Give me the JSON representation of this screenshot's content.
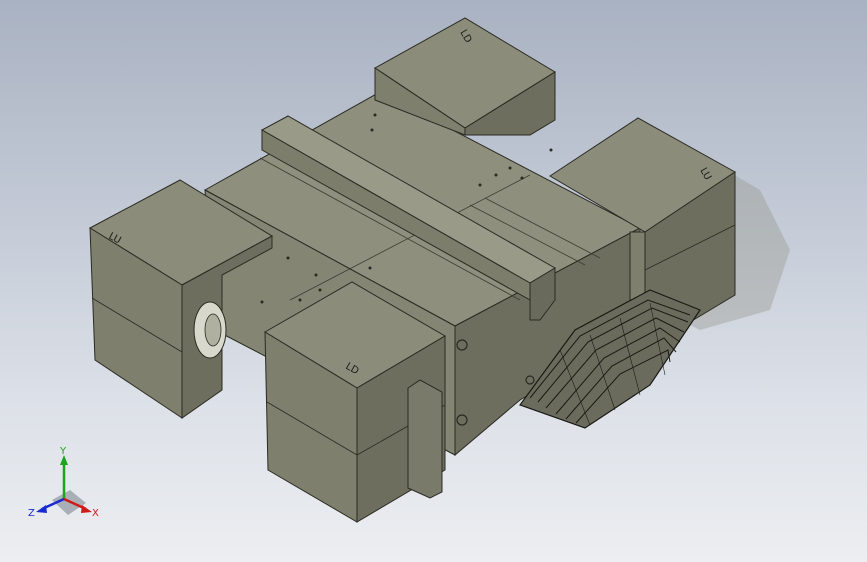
{
  "viewport": {
    "background_top": "#a9b2c2",
    "background_bottom": "#eceef1"
  },
  "model": {
    "body_top_color": "#8f8f7d",
    "body_front_color": "#858574",
    "body_side_color": "#6e6e5f",
    "block_top_color": "#8c8c7a",
    "block_face_color": "#7f7f6e",
    "edge_color": "#2a2a22",
    "block_labels": {
      "top_left": "LU",
      "top_right": "LD",
      "right": "LU",
      "front": "LD"
    }
  },
  "triad": {
    "x_label": "X",
    "y_label": "Y",
    "z_label": "Z",
    "x_color": "#d01a1a",
    "y_color": "#1aa51a",
    "z_color": "#1a2ad0"
  }
}
